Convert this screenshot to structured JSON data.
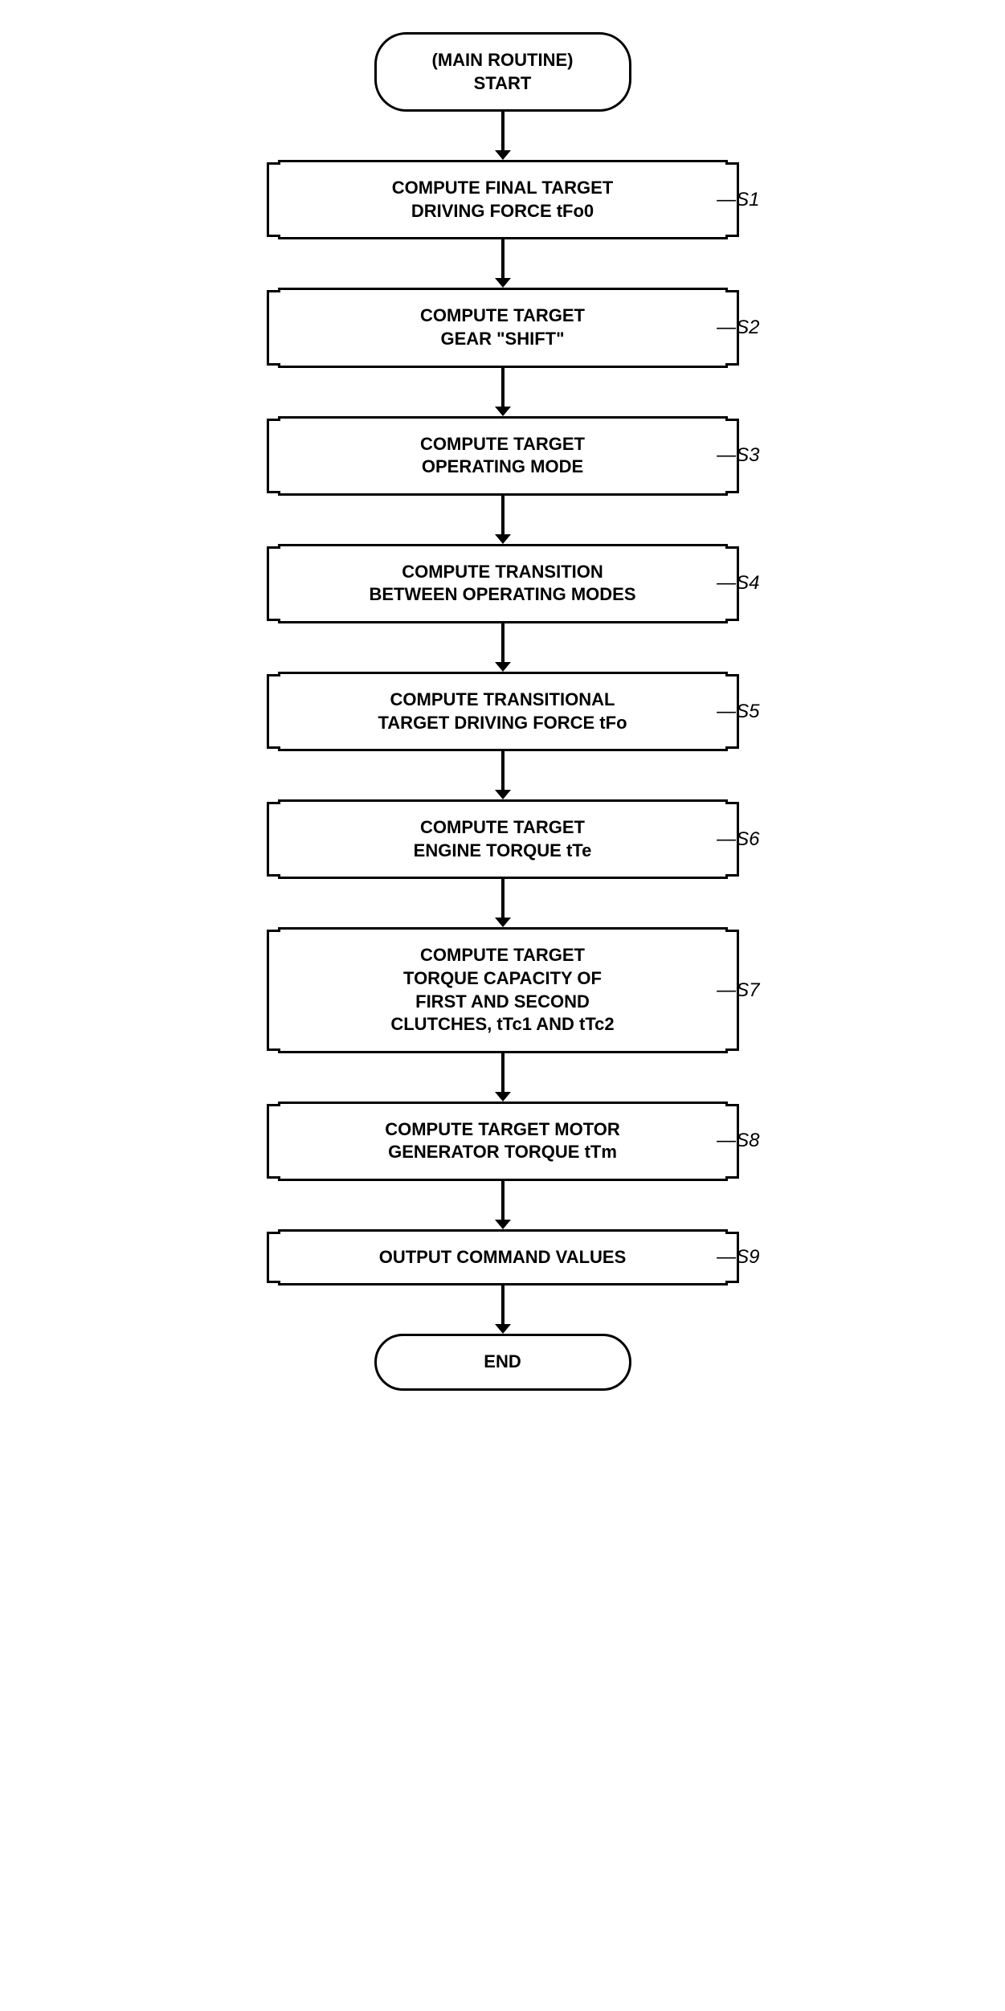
{
  "flowchart": {
    "title": "(MAIN ROUTINE)\nSTART",
    "end_label": "END",
    "steps": [
      {
        "id": "s1",
        "label": "S1",
        "text": "COMPUTE FINAL TARGET\nDRIVING FORCE tFo0"
      },
      {
        "id": "s2",
        "label": "S2",
        "text": "COMPUTE TARGET\nGEAR \"SHIFT\""
      },
      {
        "id": "s3",
        "label": "S3",
        "text": "COMPUTE TARGET\nOPERATING MODE"
      },
      {
        "id": "s4",
        "label": "S4",
        "text": "COMPUTE TRANSITION\nBETWEEN OPERATING MODES"
      },
      {
        "id": "s5",
        "label": "S5",
        "text": "COMPUTE TRANSITIONAL\nTARGET DRIVING FORCE tFo"
      },
      {
        "id": "s6",
        "label": "S6",
        "text": "COMPUTE TARGET\nENGINE TORQUE tTe"
      },
      {
        "id": "s7",
        "label": "S7",
        "text": "COMPUTE TARGET\nTORQUE CAPACITY OF\nFIRST AND SECOND\nCLUTCHES, tTc1 AND tTc2"
      },
      {
        "id": "s8",
        "label": "S8",
        "text": "COMPUTE TARGET MOTOR\nGENERATOR TORQUE tTm"
      },
      {
        "id": "s9",
        "label": "S9",
        "text": "OUTPUT COMMAND VALUES"
      }
    ]
  }
}
